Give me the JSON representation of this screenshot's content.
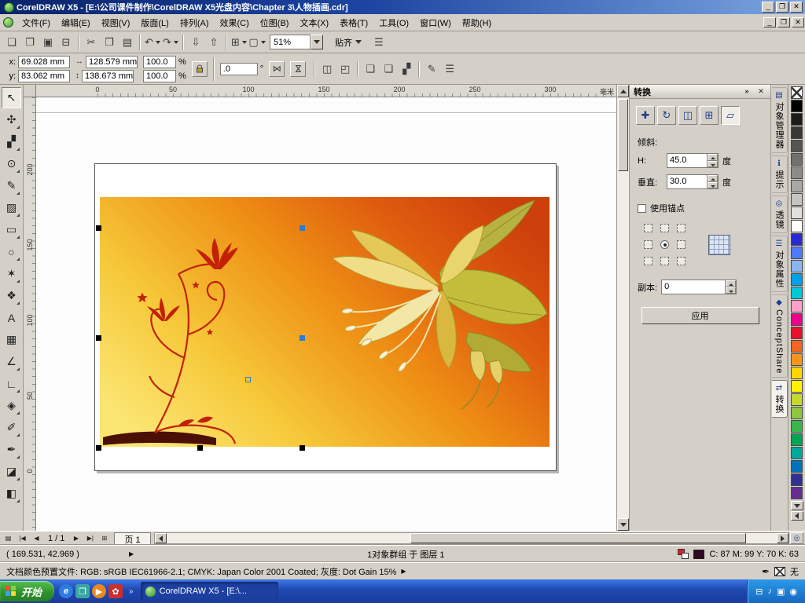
{
  "window": {
    "title": "CorelDRAW X5 - [E:\\公司课件制作\\CorelDRAW X5光盘内容\\Chapter 3\\人物插画.cdr]",
    "controls": {
      "minimize": "_",
      "maximize": "❐",
      "close": "✕"
    }
  },
  "menu": {
    "items": [
      "文件(F)",
      "编辑(E)",
      "视图(V)",
      "版面(L)",
      "排列(A)",
      "效果(C)",
      "位图(B)",
      "文本(X)",
      "表格(T)",
      "工具(O)",
      "窗口(W)",
      "帮助(H)"
    ]
  },
  "toolbar": {
    "buttons": [
      {
        "name": "new-button",
        "glyph": "❏"
      },
      {
        "name": "open-button",
        "glyph": "❐"
      },
      {
        "name": "save-button",
        "glyph": "▣"
      },
      {
        "name": "print-button",
        "glyph": "⊟"
      },
      {
        "name": "separator",
        "sep": true,
        "glyph": ""
      },
      {
        "name": "cut-button",
        "glyph": "✂"
      },
      {
        "name": "copy-button",
        "glyph": "❒"
      },
      {
        "name": "paste-button",
        "glyph": "▤"
      },
      {
        "name": "separator",
        "sep": true,
        "glyph": ""
      },
      {
        "name": "undo-button",
        "glyph": "↶",
        "dropdown": true
      },
      {
        "name": "redo-button",
        "glyph": "↷",
        "dropdown": true
      },
      {
        "name": "separator",
        "sep": true,
        "glyph": ""
      },
      {
        "name": "import-button",
        "glyph": "⇩"
      },
      {
        "name": "export-button",
        "glyph": "⇧"
      },
      {
        "name": "separator",
        "sep": true,
        "glyph": ""
      },
      {
        "name": "application-launcher-button",
        "glyph": "⊞",
        "dropdown": true
      },
      {
        "name": "welcome-screen-button",
        "glyph": "▢",
        "dropdown": true
      }
    ],
    "zoom_value": "51%",
    "snap_label": "贴齐",
    "options_glyph": "☰"
  },
  "property_bar": {
    "x_label": "x:",
    "x_value": "69.028 mm",
    "y_label": "y:",
    "y_value": "83.062 mm",
    "w_icon": "↔",
    "w_value": "128.579 mm",
    "h_icon": "↕",
    "h_value": "138.673 mm",
    "scale_h": "100.0",
    "scale_v": "100.0",
    "percent": "%",
    "angle_value": ".0",
    "angle_unit": "°",
    "mirror_glyph": "⋈",
    "buttons": [
      {
        "name": "separator",
        "sep": true,
        "glyph": ""
      },
      {
        "name": "combine-button",
        "glyph": "◫"
      },
      {
        "name": "break-apart-button",
        "glyph": "◰"
      },
      {
        "name": "separator",
        "sep": true,
        "glyph": ""
      },
      {
        "name": "group-button",
        "glyph": "❑"
      },
      {
        "name": "ungroup-button",
        "glyph": "❏"
      },
      {
        "name": "ungroup-all-button",
        "glyph": "▞"
      },
      {
        "name": "separator",
        "sep": true,
        "glyph": ""
      },
      {
        "name": "convert-to-curves-button",
        "glyph": "✎"
      },
      {
        "name": "wrap-text-button",
        "glyph": "☰"
      }
    ]
  },
  "toolbox": {
    "tools": [
      {
        "name": "pick-tool",
        "glyph": "↖",
        "selected": true
      },
      {
        "name": "shape-tool",
        "glyph": "✣",
        "flyout": true
      },
      {
        "name": "crop-tool",
        "glyph": "▞",
        "flyout": true
      },
      {
        "name": "zoom-tool",
        "glyph": "⊙",
        "flyout": true
      },
      {
        "name": "freehand-tool",
        "glyph": "✎",
        "flyout": true
      },
      {
        "name": "smart-fill-tool",
        "glyph": "▨",
        "flyout": true
      },
      {
        "name": "rectangle-tool",
        "glyph": "▭",
        "flyout": true
      },
      {
        "name": "ellipse-tool",
        "glyph": "○",
        "flyout": true
      },
      {
        "name": "polygon-tool",
        "glyph": "✶",
        "flyout": true
      },
      {
        "name": "basic-shapes-tool",
        "glyph": "❖",
        "flyout": true
      },
      {
        "name": "text-tool",
        "glyph": "A"
      },
      {
        "name": "table-tool",
        "glyph": "▦"
      },
      {
        "name": "parallel-dimension-tool",
        "glyph": "∠",
        "flyout": true
      },
      {
        "name": "straight-line-connector-tool",
        "glyph": "∟",
        "flyout": true
      },
      {
        "name": "blend-tool",
        "glyph": "◈",
        "flyout": true
      },
      {
        "name": "color-eyedropper-tool",
        "glyph": "✐",
        "flyout": true
      },
      {
        "name": "outline-pen-tool",
        "glyph": "✒",
        "flyout": true
      },
      {
        "name": "fill-tool",
        "glyph": "◪",
        "flyout": true
      },
      {
        "name": "interactive-fill-tool",
        "glyph": "◧",
        "flyout": true
      }
    ]
  },
  "ruler": {
    "unit": "毫米",
    "h_ticks": [
      "0",
      "50",
      "100",
      "150",
      "200",
      "250",
      "300"
    ],
    "v_ticks": [
      "200",
      "150",
      "100",
      "50",
      "0"
    ]
  },
  "docker": {
    "title": "转换",
    "collapse_glyph": "»",
    "close_glyph": "✕",
    "modes": [
      {
        "name": "position-mode-button",
        "glyph": "✚"
      },
      {
        "name": "rotate-mode-button",
        "glyph": "↻"
      },
      {
        "name": "scale-mirror-mode-button",
        "glyph": "◫"
      },
      {
        "name": "size-mode-button",
        "glyph": "⊞"
      },
      {
        "name": "skew-mode-button",
        "glyph": "▱",
        "selected": true
      }
    ],
    "section_label": "倾斜:",
    "h_label": "H:",
    "h_value": "45.0",
    "h_unit": "度",
    "v_label": "垂直:",
    "v_value": "30.0",
    "v_unit": "度",
    "anchor_label": "使用锚点",
    "copies_label": "副本:",
    "copies_value": "0",
    "apply_label": "应用"
  },
  "docker_tabs": [
    {
      "name": "tab-object-manager",
      "icon": "▤",
      "label": "对象管理器"
    },
    {
      "name": "tab-hints",
      "icon": "ℹ",
      "label": "提示"
    },
    {
      "name": "tab-lens",
      "icon": "◎",
      "label": "透镜"
    },
    {
      "name": "tab-object-properties",
      "icon": "☰",
      "label": "对象属性"
    },
    {
      "name": "tab-conceptshare",
      "icon": "◆",
      "label": "ConceptShare"
    },
    {
      "name": "tab-transform",
      "icon": "⇄",
      "label": "转换",
      "active": true
    }
  ],
  "palette": {
    "colors": [
      "#000000",
      "#1c1c1c",
      "#383838",
      "#545454",
      "#707070",
      "#8c8c8c",
      "#a8a8a8",
      "#c4c4c4",
      "#e0e0e0",
      "#ffffff",
      "#2a2ad4",
      "#4d79ff",
      "#8ab6f0",
      "#00a0e9",
      "#00c8d7",
      "#ff9ecb",
      "#ec008c",
      "#e8112d",
      "#f26522",
      "#f7941d",
      "#ffd500",
      "#fff200",
      "#c4d82d",
      "#8dc63f",
      "#39b54a",
      "#00a651",
      "#00a99d",
      "#0072bc",
      "#2e3192",
      "#662d91"
    ]
  },
  "page_nav": {
    "pages_glyph": "▤",
    "first_glyph": "|◀",
    "prev_glyph": "◀",
    "info": "1 / 1",
    "next_glyph": "▶",
    "last_glyph": "▶|",
    "add_glyph": "⊞",
    "tab_label": "页 1",
    "navigator_glyph": "◎"
  },
  "status": {
    "coords": "( 169.531, 42.969 )",
    "arrow": "▶",
    "selection": "1对象群组 于 图层 1",
    "fill_color": "#2e0a20",
    "fill_text": "C: 87 M: 99 Y: 70 K: 63",
    "outline_pen_glyph": "✒",
    "outline_text": "无",
    "doc_profile": "文档颜色预置文件: RGB: sRGB IEC61966-2.1; CMYK: Japan Color 2001 Coated; 灰度: Dot Gain 15%"
  },
  "taskbar": {
    "start_label": "开始",
    "quicklaunch": [
      {
        "name": "internet-explorer-icon",
        "glyph": "e"
      },
      {
        "name": "show-desktop-icon",
        "glyph": "❐"
      },
      {
        "name": "media-player-icon",
        "glyph": "▶"
      },
      {
        "name": "red-app-icon",
        "glyph": "✿"
      }
    ],
    "quicklaunch_overflow": "»",
    "task_label": "CorelDRAW X5 - [E:\\...",
    "tray": [
      {
        "name": "printer-tray-icon",
        "glyph": "⊟"
      },
      {
        "name": "volume-tray-icon",
        "glyph": "♪"
      },
      {
        "name": "network-tray-icon",
        "glyph": "▣"
      },
      {
        "name": "language-tray-icon",
        "glyph": "◉"
      }
    ]
  }
}
